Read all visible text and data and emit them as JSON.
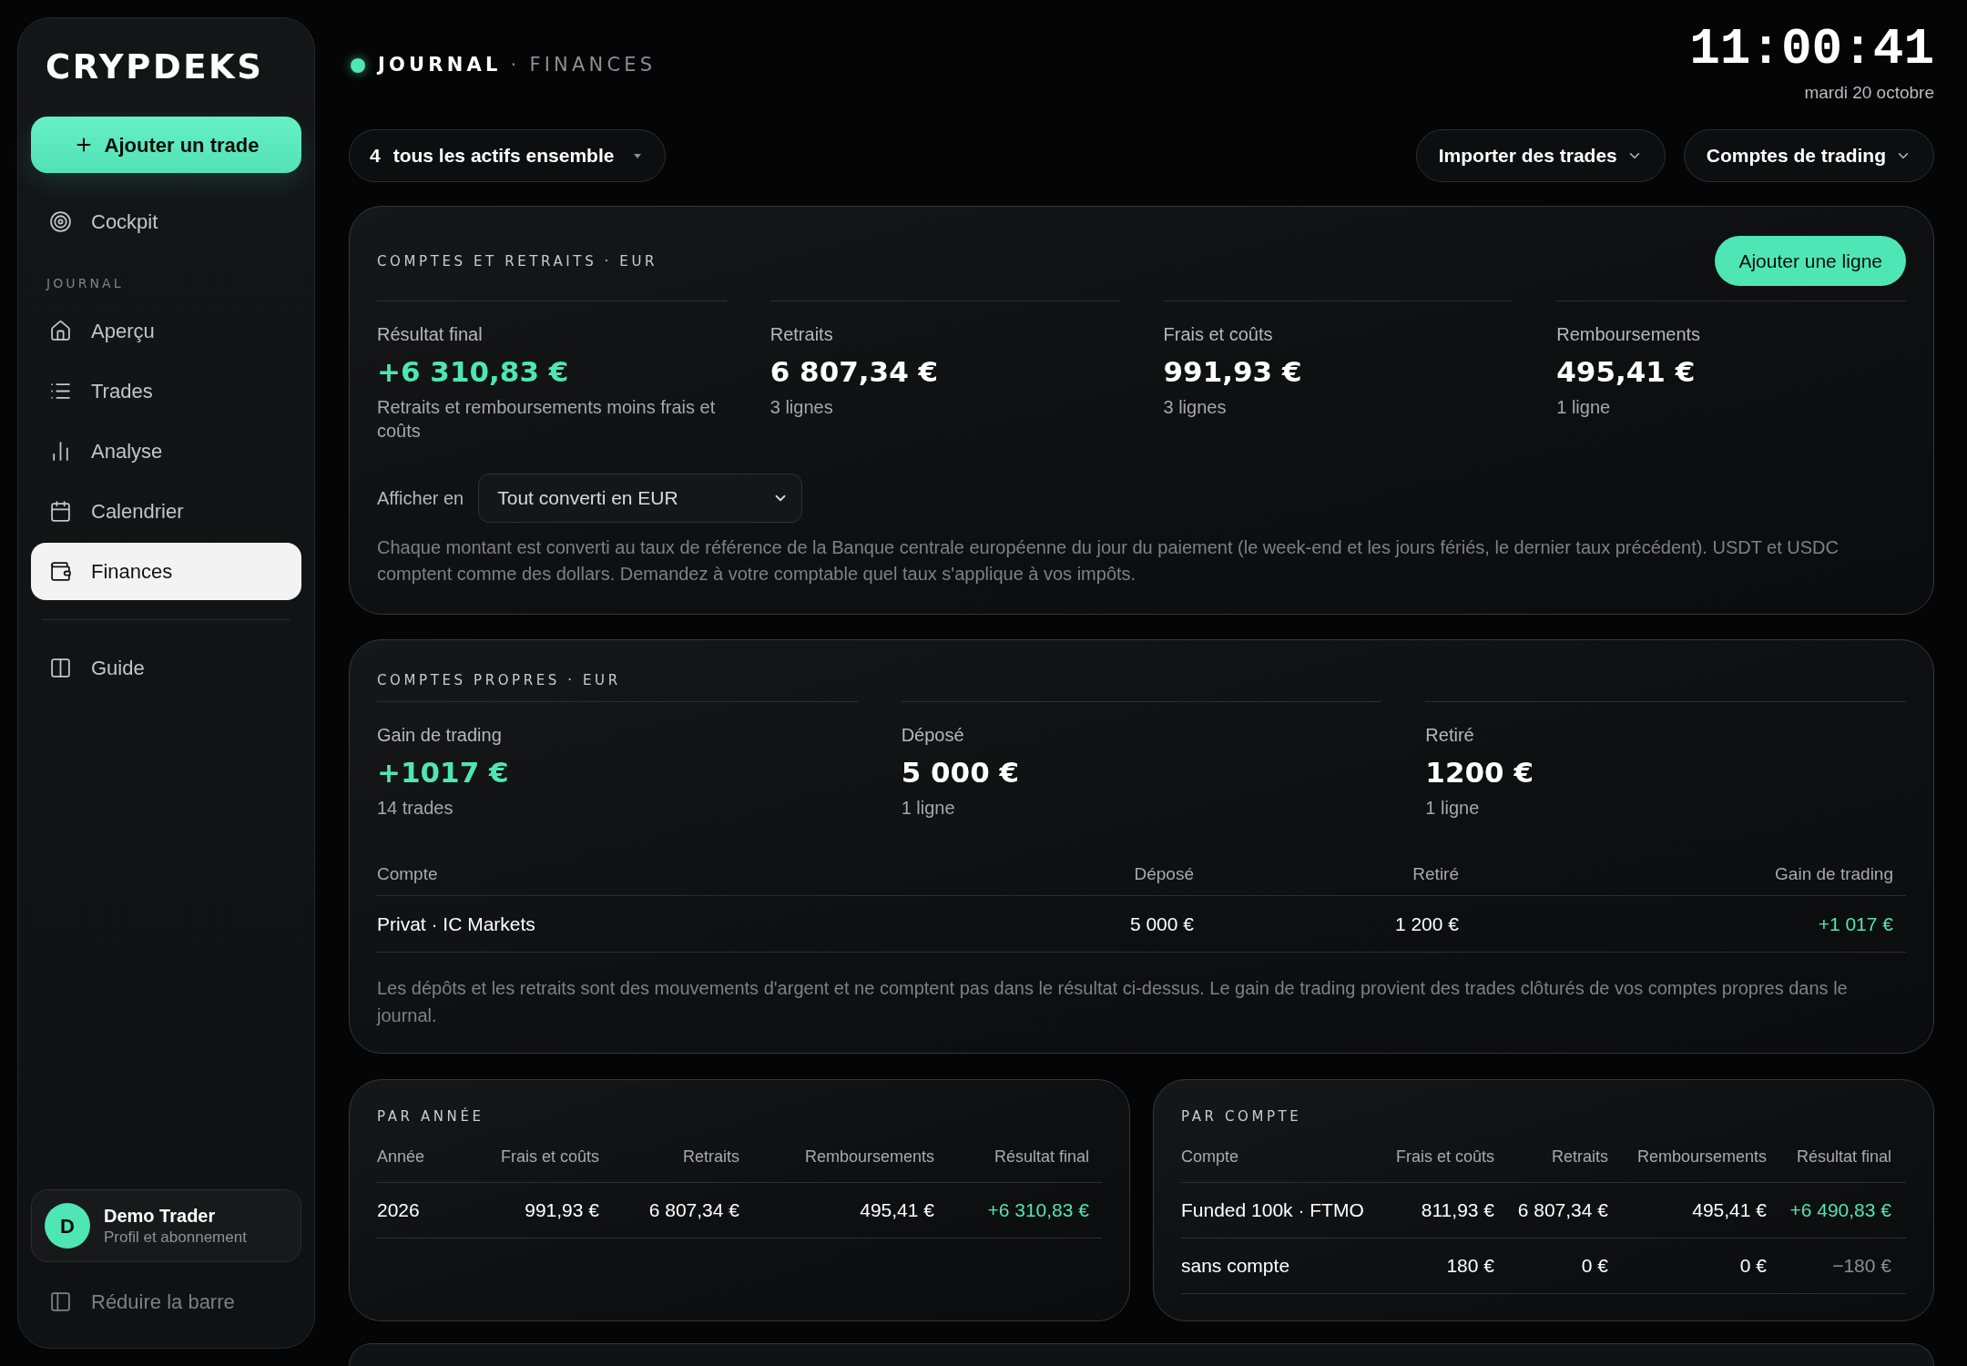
{
  "sidebar": {
    "logo": "CRYPDEKS",
    "add_button": "Ajouter un trade",
    "top_items": [
      {
        "label": "Cockpit",
        "selected": false
      }
    ],
    "journal": {
      "title": "JOURNAL",
      "items": [
        {
          "label": "Aperçu",
          "selected": false
        },
        {
          "label": "Trades",
          "selected": false
        },
        {
          "label": "Analyse",
          "selected": false
        },
        {
          "label": "Calendrier",
          "selected": false
        },
        {
          "label": "Finances",
          "selected": true
        }
      ]
    },
    "bottom_items": [
      {
        "label": "Guide",
        "selected": false
      }
    ],
    "user": {
      "initial": "D",
      "name": "Demo Trader",
      "subtitle": "Profil et abonnement"
    },
    "collapse_button": "Réduire la barre"
  },
  "header": {
    "section": "JOURNAL",
    "separator": "·",
    "page": "FINANCES",
    "clock": "11:00:41",
    "date": "mardi 20 octobre"
  },
  "toolbar": {
    "asset_filter": {
      "count": "4",
      "label": "tous les actifs ensemble"
    },
    "buttons": [
      "Importer des trades",
      "Comptes de trading"
    ]
  },
  "accounts_and_withdrawals": {
    "title": "COMPTES ET RETRAITS · EUR",
    "add_button": "Ajouter une ligne",
    "stats": [
      {
        "label": "Résultat final",
        "value": "+6 310,83 €",
        "note": "Retraits et remboursements moins frais et coûts",
        "color": "#4ee6b4"
      },
      {
        "label": "Retraits",
        "value": "6 807,34 €",
        "note": "3 lignes",
        "color": "#ffffff"
      },
      {
        "label": "Frais et coûts",
        "value": "991,93 €",
        "note": "3 lignes",
        "color": "#ffffff"
      },
      {
        "label": "Remboursements",
        "value": "495,41 €",
        "note": "1 ligne",
        "color": "#ffffff"
      }
    ],
    "display": {
      "label": "Afficher en",
      "value": "Tout converti en EUR"
    },
    "note": "Chaque montant est converti au taux de référence de la Banque centrale européenne du jour du paiement (le week-end et les jours fériés, le dernier taux précédent). USDT et USDC comptent comme des dollars. Demandez à votre comptable quel taux s'applique à vos impôts."
  },
  "own_accounts": {
    "title": "COMPTES PROPRES · EUR",
    "stats": [
      {
        "label": "Gain de trading",
        "value": "+1017 €",
        "note": "14 trades",
        "color": "#4ee6b4"
      },
      {
        "label": "Déposé",
        "value": "5 000 €",
        "note": "1 ligne",
        "color": "#ffffff"
      },
      {
        "label": "Retiré",
        "value": "1200 €",
        "note": "1 ligne",
        "color": "#ffffff"
      }
    ],
    "table": {
      "columns": [
        "Compte",
        "Déposé",
        "Retiré",
        "Gain de trading"
      ],
      "rows": [
        {
          "cells": [
            "Privat · IC Markets",
            "5 000 €",
            "1 200 €",
            "+1 017 €"
          ],
          "color": "#4ee6b4"
        }
      ]
    },
    "note": "Les dépôts et les retraits sont des mouvements d'argent et ne comptent pas dans le résultat ci-dessus. Le gain de trading provient des trades clôturés de vos comptes propres dans le journal."
  },
  "by_year": {
    "title": "PAR ANNÉE",
    "columns": [
      "Année",
      "Frais et coûts",
      "Retraits",
      "Remboursements",
      "Résultat final"
    ],
    "rows": [
      {
        "cells": [
          "2026",
          "991,93 €",
          "6 807,34 €",
          "495,41 €",
          "+6 310,83 €"
        ],
        "color": "#4ee6b4"
      }
    ]
  },
  "by_account": {
    "title": "PAR COMPTE",
    "columns": [
      "Compte",
      "Frais et coûts",
      "Retraits",
      "Remboursements",
      "Résultat final"
    ],
    "rows": [
      {
        "cells": [
          "Funded 100k · FTMO",
          "811,93 €",
          "6 807,34 €",
          "495,41 €",
          "+6 490,83 €"
        ],
        "color": "#4ee6b4"
      },
      {
        "cells": [
          "sans compte",
          "180 €",
          "0 €",
          "0 €",
          "−180 €"
        ],
        "color": "#8b8f94"
      }
    ]
  }
}
